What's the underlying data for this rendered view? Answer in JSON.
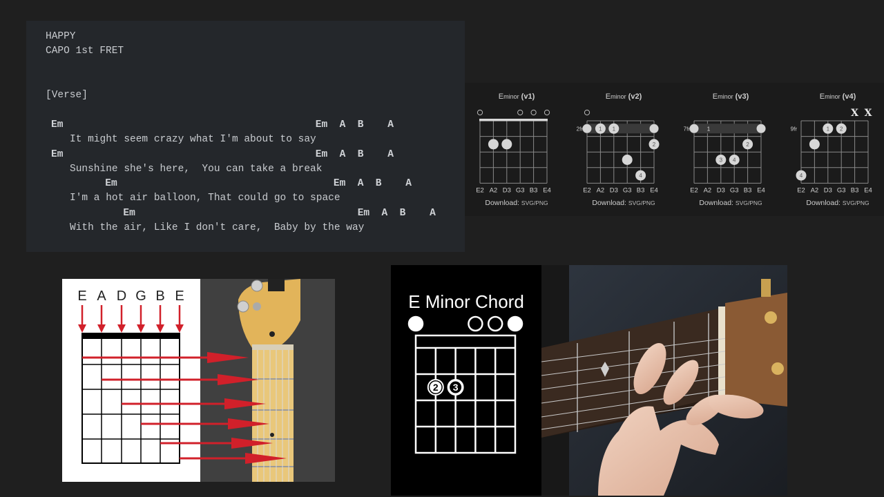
{
  "lyrics": {
    "title": "HAPPY",
    "capo": "CAPO 1st FRET",
    "section": "[Verse]",
    "lines": [
      {
        "chords": [
          {
            "t": "Em",
            "col": 0
          },
          {
            "t": "Em  A  B    A",
            "col": 44
          }
        ],
        "text": "It might seem crazy what I'm about to say"
      },
      {
        "chords": [
          {
            "t": "Em",
            "col": 0
          },
          {
            "t": "Em  A  B    A",
            "col": 44
          }
        ],
        "text": "Sunshine she's here,  You can take a break"
      },
      {
        "chords": [
          {
            "t": "Em",
            "col": 9
          },
          {
            "t": "Em  A  B    A",
            "col": 47
          }
        ],
        "text": "I'm a hot air balloon, That could go to space"
      },
      {
        "chords": [
          {
            "t": "Em",
            "col": 12
          },
          {
            "t": "Em  A  B    A",
            "col": 51
          }
        ],
        "text": "With the air, Like I don't care,  Baby by the way"
      }
    ]
  },
  "chord_diagrams": [
    {
      "name": "E",
      "quality": "minor",
      "version": "(v1)",
      "fret_label": "",
      "strings": [
        "E2",
        "A2",
        "D3",
        "G3",
        "B3",
        "E4"
      ],
      "open": [
        0,
        3,
        4,
        5
      ],
      "muted": [],
      "nut": true,
      "barre": null,
      "dots": [
        {
          "s": 1,
          "f": 2,
          "l": ""
        },
        {
          "s": 2,
          "f": 2,
          "l": ""
        }
      ],
      "download": "Download:",
      "formats": "SVG/PNG"
    },
    {
      "name": "E",
      "quality": "minor",
      "version": "(v2)",
      "fret_label": "2fr",
      "strings": [
        "E2",
        "A2",
        "D3",
        "G3",
        "B3",
        "E4"
      ],
      "open": [
        0
      ],
      "muted": [],
      "nut": false,
      "barre": {
        "from": 0,
        "to": 5,
        "f": 1,
        "l": "1"
      },
      "dots": [
        {
          "s": 1,
          "f": 1,
          "l": "1"
        },
        {
          "s": 2,
          "f": 1,
          "l": "1"
        },
        {
          "s": 5,
          "f": 2,
          "l": "2"
        },
        {
          "s": 3,
          "f": 3,
          "l": ""
        },
        {
          "s": 4,
          "f": 4,
          "l": "4"
        }
      ],
      "download": "Download:",
      "formats": "SVG/PNG"
    },
    {
      "name": "E",
      "quality": "minor",
      "version": "(v3)",
      "fret_label": "7fr",
      "strings": [
        "E2",
        "A2",
        "D3",
        "G3",
        "B3",
        "E4"
      ],
      "open": [],
      "muted": [],
      "nut": false,
      "barre": {
        "from": 0,
        "to": 5,
        "f": 1,
        "l": "1"
      },
      "dots": [
        {
          "s": 4,
          "f": 2,
          "l": "2"
        },
        {
          "s": 2,
          "f": 3,
          "l": "3"
        },
        {
          "s": 3,
          "f": 3,
          "l": "4"
        }
      ],
      "download": "Download:",
      "formats": "SVG/PNG"
    },
    {
      "name": "E",
      "quality": "minor",
      "version": "(v4)",
      "fret_label": "9fr",
      "strings": [
        "E2",
        "A2",
        "D3",
        "G3",
        "B3",
        "E4"
      ],
      "open": [],
      "muted": [
        4,
        5
      ],
      "nut": false,
      "barre": null,
      "dots": [
        {
          "s": 2,
          "f": 1,
          "l": "1"
        },
        {
          "s": 3,
          "f": 1,
          "l": "2"
        },
        {
          "s": 1,
          "f": 2,
          "l": ""
        },
        {
          "s": 0,
          "f": 4,
          "l": "4"
        }
      ],
      "download": "Download:",
      "formats": "SVG/PNG"
    }
  ],
  "string_chart": {
    "labels": [
      "E",
      "A",
      "D",
      "G",
      "B",
      "E"
    ]
  },
  "em_image": {
    "title": "E Minor Chord",
    "finger_labels": [
      "2",
      "3"
    ]
  }
}
